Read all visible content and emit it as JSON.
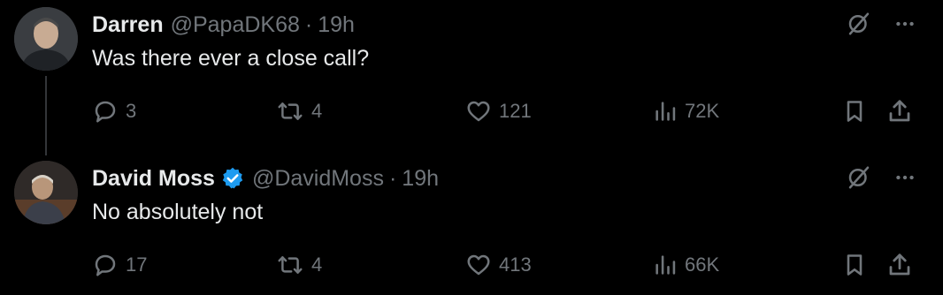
{
  "tweets": [
    {
      "name": "Darren",
      "verified": false,
      "handle": "@PapaDK68",
      "separator": "·",
      "time": "19h",
      "text": "Was there ever a close call?",
      "reply_count": "3",
      "repost_count": "4",
      "like_count": "121",
      "view_count": "72K"
    },
    {
      "name": "David Moss",
      "verified": true,
      "handle": "@DavidMoss",
      "separator": "·",
      "time": "19h",
      "text": "No absolutely not",
      "reply_count": "17",
      "repost_count": "4",
      "like_count": "413",
      "view_count": "66K"
    }
  ],
  "colors": {
    "background": "#000000",
    "primary_text": "#e7e9ea",
    "secondary_text": "#71767b",
    "verified_blue": "#1d9bf0",
    "thread_line": "#333639"
  },
  "icons": {
    "reply": "reply-icon",
    "repost": "repost-icon",
    "like": "heart-icon",
    "views": "views-chart-icon",
    "bookmark": "bookmark-icon",
    "share": "share-icon",
    "grok": "grok-icon",
    "more": "more-icon",
    "verified": "verified-badge-icon"
  }
}
